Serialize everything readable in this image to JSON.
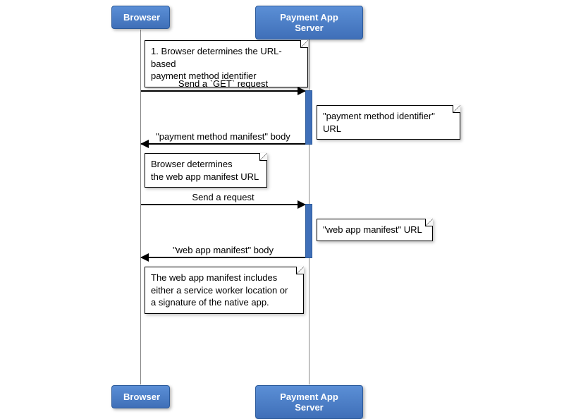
{
  "participants": {
    "left": "Browser",
    "right": "Payment App Server"
  },
  "notes": {
    "n1": "1. Browser determines the URL-based\npayment method identifier",
    "n2": "\"payment method identifier\" URL",
    "n3": "Browser determines\nthe web app manifest URL",
    "n4": "\"web app manifest\" URL",
    "n5": "The web app manifest includes\neither a service worker location or\na signature of the native app."
  },
  "messages": {
    "m1": "Send a `GET` request",
    "m2": "\"payment method manifest\" body",
    "m3": "Send a request",
    "m4": "\"web app manifest\" body"
  },
  "chart_data": {
    "type": "sequence-diagram",
    "participants": [
      "Browser",
      "Payment App Server"
    ],
    "events": [
      {
        "kind": "note",
        "over": "Browser",
        "text": "1. Browser determines the URL-based payment method identifier"
      },
      {
        "kind": "message",
        "from": "Browser",
        "to": "Payment App Server",
        "label": "Send a `GET` request"
      },
      {
        "kind": "note",
        "over": "Payment App Server",
        "text": "\"payment method identifier\" URL"
      },
      {
        "kind": "message",
        "from": "Payment App Server",
        "to": "Browser",
        "label": "\"payment method manifest\" body"
      },
      {
        "kind": "note",
        "over": "Browser",
        "text": "Browser determines the web app manifest URL"
      },
      {
        "kind": "message",
        "from": "Browser",
        "to": "Payment App Server",
        "label": "Send a request"
      },
      {
        "kind": "note",
        "over": "Payment App Server",
        "text": "\"web app manifest\" URL"
      },
      {
        "kind": "message",
        "from": "Payment App Server",
        "to": "Browser",
        "label": "\"web app manifest\" body"
      },
      {
        "kind": "note",
        "over": "Browser",
        "text": "The web app manifest includes either a service worker location or a signature of the native app."
      }
    ]
  }
}
